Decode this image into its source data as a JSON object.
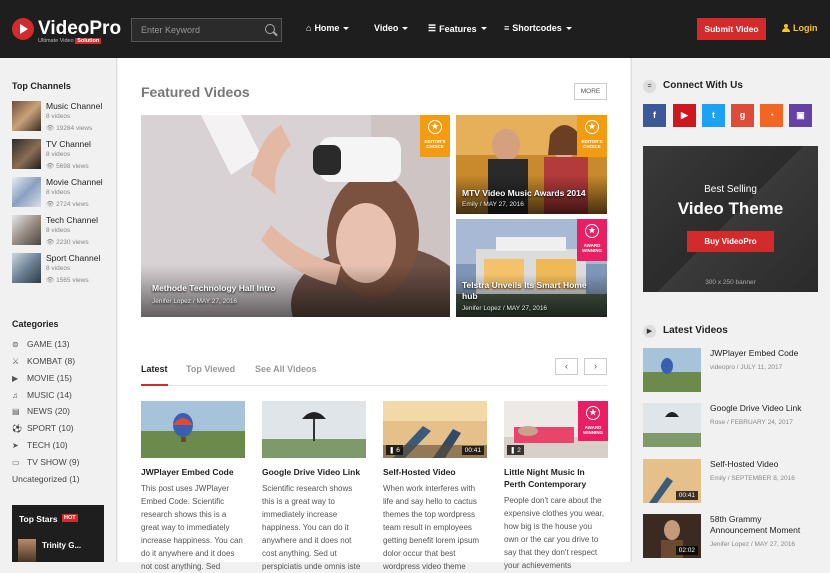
{
  "header": {
    "logo_name": "VideoPro",
    "logo_tagline_a": "Ultimate Video",
    "logo_tagline_b": "Solution",
    "search_placeholder": "Enter Keyword",
    "nav": [
      {
        "label": "Home",
        "icon": "home-icon"
      },
      {
        "label": "Video",
        "icon": ""
      },
      {
        "label": "Features",
        "icon": "menu-icon"
      },
      {
        "label": "Shortcodes",
        "icon": "database-icon"
      }
    ],
    "submit_label": "Submit Video",
    "login_label": "Login"
  },
  "left_sidebar": {
    "channels_title": "Top Channels",
    "channels": [
      {
        "name": "Music Channel",
        "videos": "8 videos",
        "views": "19284 views"
      },
      {
        "name": "TV Channel",
        "videos": "8 videos",
        "views": "5698 views"
      },
      {
        "name": "Movie Channel",
        "videos": "8 videos",
        "views": "2724 views"
      },
      {
        "name": "Tech Channel",
        "videos": "8 videos",
        "views": "2230 views"
      },
      {
        "name": "Sport Channel",
        "videos": "8 videos",
        "views": "1565 views"
      }
    ],
    "categories_title": "Categories",
    "categories": [
      {
        "label": "GAME",
        "count": "(13)",
        "icon": "gamepad-icon"
      },
      {
        "label": "KOMBAT",
        "count": "(8)",
        "icon": "swords-icon"
      },
      {
        "label": "MOVIE",
        "count": "(15)",
        "icon": "play-circle-icon"
      },
      {
        "label": "MUSIC",
        "count": "(14)",
        "icon": "music-icon"
      },
      {
        "label": "NEWS",
        "count": "(20)",
        "icon": "newspaper-icon"
      },
      {
        "label": "SPORT",
        "count": "(10)",
        "icon": "soccer-ball-icon"
      },
      {
        "label": "TECH",
        "count": "(10)",
        "icon": "rocket-icon"
      },
      {
        "label": "TV SHOW",
        "count": "(9)",
        "icon": "tv-icon"
      },
      {
        "label": "Uncategorized",
        "count": "(1)",
        "icon": ""
      }
    ],
    "top_stars_title": "Top Stars",
    "top_stars_badge": "HOT",
    "top_star_name": "Trinity G..."
  },
  "main": {
    "featured_title": "Featured Videos",
    "more_label": "MORE",
    "featured": [
      {
        "title": "Methode Technology Hall Intro",
        "author": "Jenifer Lopez",
        "date": "MAY 27, 2016",
        "badge": "EDITOR'S CHOICE"
      },
      {
        "title": "MTV Video Music Awards 2014",
        "author": "Emily",
        "date": "MAY 27, 2016",
        "badge": "EDITOR'S CHOICE"
      },
      {
        "title": "Telstra Unveils Its Smart Home hub",
        "author": "Jenifer Lopez",
        "date": "MAY 27, 2016",
        "badge": "AWARD WINNING"
      }
    ],
    "tabs": [
      "Latest",
      "Top Viewed",
      "See All Videos"
    ],
    "cards": [
      {
        "title": "JWPlayer Embed Code",
        "desc": "This post uses JWPlayer Embed Code. Scientific research shows this is a great way to immediately increase happiness. You can do it anywhere and it does not cost anything. Sed",
        "duration": "",
        "badge": ""
      },
      {
        "title": "Google Drive Video Link",
        "desc": "Scientific research shows this is a great way to immediately increase happiness. You can do it anywhere and it does not cost anything. Sed ut perspiciatis unde omnis iste",
        "duration": "",
        "badge": ""
      },
      {
        "title": "Self-Hosted Video",
        "desc": "When work interferes with life and say hello to cactus themes the top wordpress team result in employees getting benefit lorem ipsum dolor occur that best wordpress video theme",
        "duration": "00:41",
        "count": "6",
        "badge": ""
      },
      {
        "title": "Little Night Music In Perth Contemporary",
        "desc": "People don't care about the expensive clothes you wear, how big is the house you own or the car you drive to say that they don't respect your achievements",
        "duration": "",
        "count": "2",
        "badge": "AWARD WINNING"
      }
    ]
  },
  "right_sidebar": {
    "connect_title": "Connect With Us",
    "social": [
      {
        "name": "facebook-icon",
        "glyph": "f",
        "color": "#3b5998"
      },
      {
        "name": "youtube-icon",
        "glyph": "▶",
        "color": "#cc181e"
      },
      {
        "name": "twitter-icon",
        "glyph": "t",
        "color": "#1da1f2"
      },
      {
        "name": "google-plus-icon",
        "glyph": "g",
        "color": "#dd4b39"
      },
      {
        "name": "rss-icon",
        "glyph": "◔",
        "color": "#f26522"
      },
      {
        "name": "twitch-icon",
        "glyph": "▣",
        "color": "#6441a5"
      }
    ],
    "banner_line1": "Best Selling",
    "banner_line2": "Video Theme",
    "banner_button": "Buy VideoPro",
    "banner_size": "300 x 250 banner",
    "latest_title": "Latest Videos",
    "latest": [
      {
        "title": "JWPlayer Embed Code",
        "author": "videopro",
        "date": "JULY 11, 2017",
        "duration": ""
      },
      {
        "title": "Google Drive Video Link",
        "author": "Rose",
        "date": "FEBRUARY 24, 2017",
        "duration": ""
      },
      {
        "title": "Self-Hosted Video",
        "author": "Emily",
        "date": "SEPTEMBER 8, 2016",
        "duration": "00:41"
      },
      {
        "title": "58th Grammy Announcement Moment",
        "author": "Jenifer Lopez",
        "date": "MAY 27, 2016",
        "duration": "02:02"
      }
    ]
  }
}
